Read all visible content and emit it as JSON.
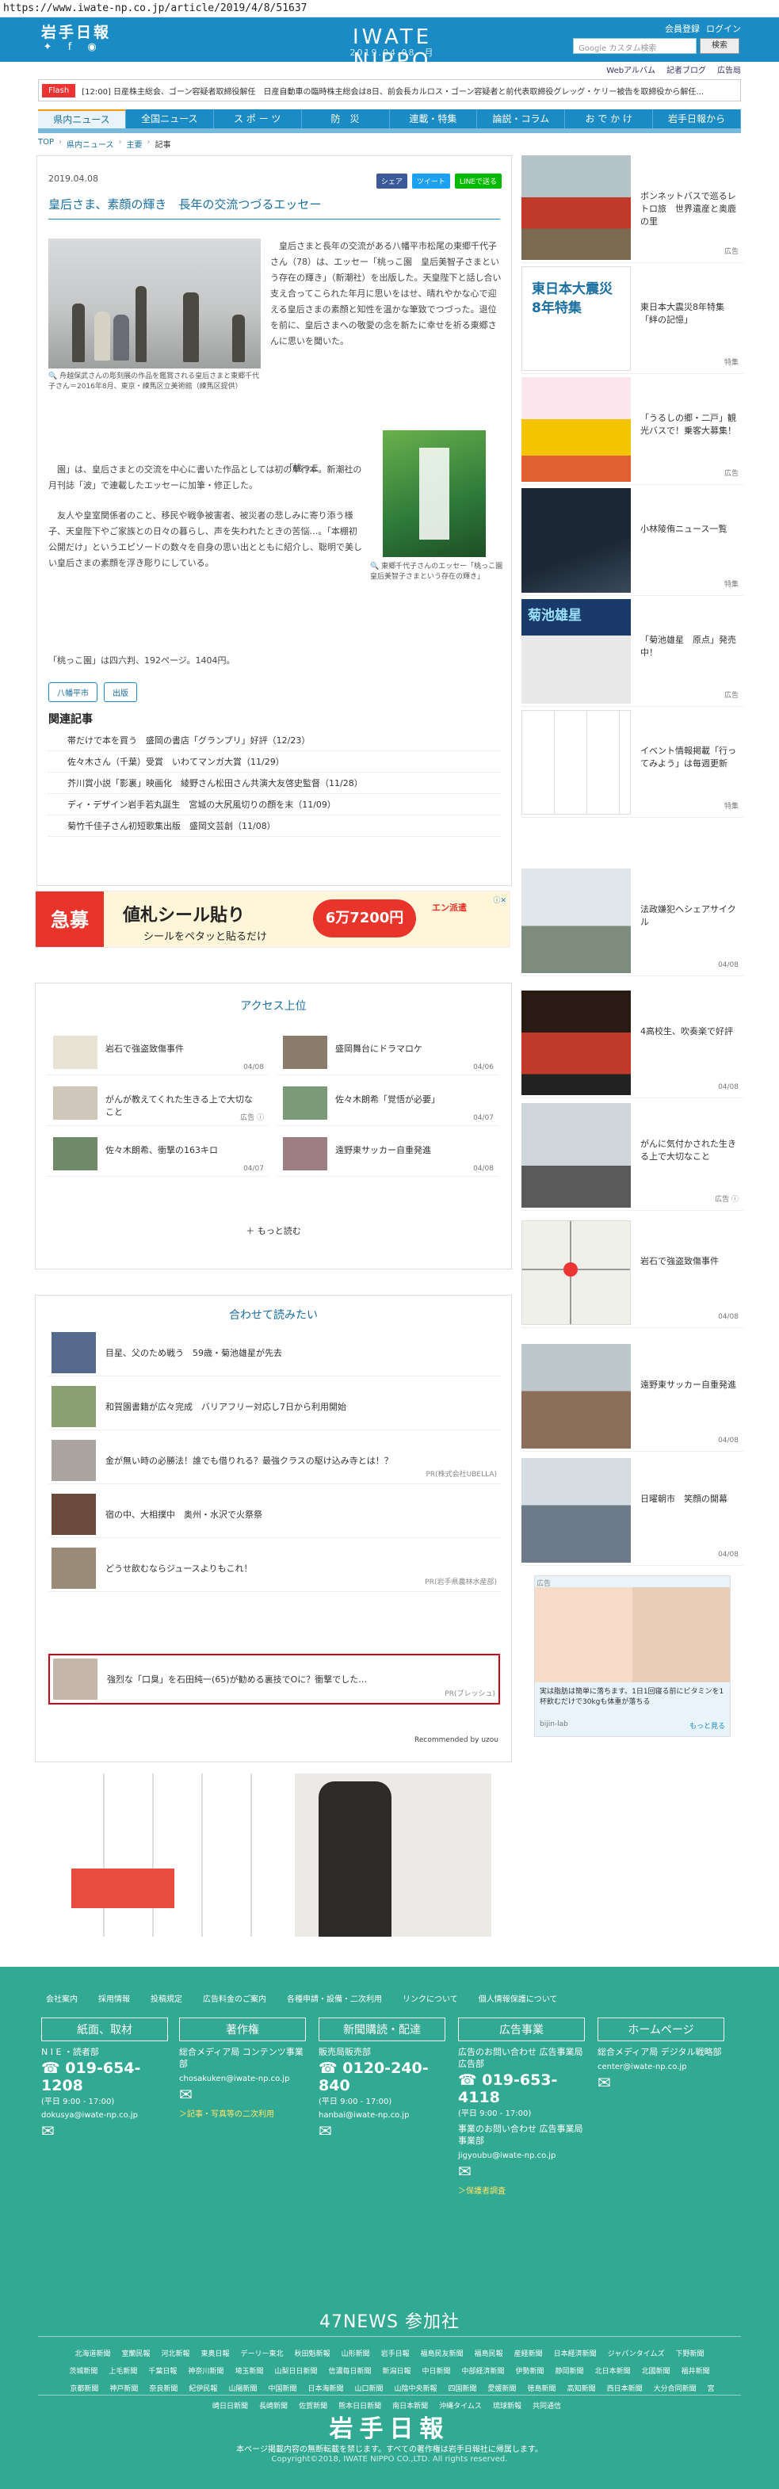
{
  "url": "https://www.iwate-np.co.jp/article/2019/4/8/51637",
  "header": {
    "logo_left": "岩手日報",
    "logo_center": "IWATE NIPPO",
    "date_line": "2019.04.08. 月",
    "top_links": [
      "会員登録",
      "ログイン"
    ],
    "search_placeholder": "Google カスタム検索",
    "search_button": "検索",
    "sub_links": [
      "Webアルバム",
      "記者ブログ",
      "広告局"
    ]
  },
  "flash": {
    "badge": "Flash",
    "text": "[12:00] 日産株主総会、ゴーン容疑者取締役解任　日産自動車の臨時株主総会は8日、前会長カルロス・ゴーン容疑者と前代表取締役グレッグ・ケリー被告を取締役から解任…"
  },
  "nav": [
    "県内ニュース",
    "全国ニュース",
    "ス ポ ー ツ",
    "防　災",
    "連載・特集",
    "論説・コラム",
    "お で か け",
    "岩手日報から"
  ],
  "breadcrumb": [
    "TOP",
    "県内ニュース",
    "主要",
    "記事"
  ],
  "article": {
    "date": "2019.04.08",
    "share": [
      "シェア",
      "ツイート",
      "LINEで送る"
    ],
    "title": "皇后さま、素顔の輝き　長年の交流つづるエッセー",
    "photo1_caption": "舟越保武さんの彫刻展の作品を鑑賞される皇后さまと東郷千代子さん＝2016年8月、東京・練馬区立美術館（練馬区提供）",
    "para1": "皇后さまと長年の交流がある八幡平市松尾の東郷千代子さん（78）は、エッセー「桃っこ園　皇后美智子さまという存在の輝き」（新潮社）を出版した。天皇陛下と話し合い支え合ってこられた年月に思いをはせ、晴れやかな心で迎える皇后さまの素顔と知性を温かな筆致でつづった。退位を前に、皇后さまへの敬愛の念を新たに幸せを祈る東郷さんに思いを聞いた。",
    "para2_lead": "「桃っこ",
    "para2": "園」は、皇后さまとの交流を中心に書いた作品としては初の単行本。新潮社の月刊誌「波」で連載したエッセーに加筆・修正した。",
    "para2b": "友人や皇室関係者のこと、移民や戦争被害者、被災者の悲しみに寄り添う様子、天皇陛下やご家族との日々の暮らし、声を失われたときの苦悩…。「本棚初公開だけ」というエピソードの数々を自身の思い出とともに紹介し、聡明で美しい皇后さまの素顔を浮き彫りにしている。",
    "book_caption": "東郷千代子さんのエッセー「桃っこ園　皇后美智子さまという存在の輝き」",
    "para3": "「桃っこ園」は四六判、192ページ。1404円。",
    "tags": [
      "八幡平市",
      "出版"
    ],
    "related_title": "関連記事",
    "related": [
      "帯だけで本を買う　盛岡の書店「グランプリ」好評（12/23）",
      "佐々木さん（千葉）受賞　いわてマンガ大賞（11/29）",
      "芥川賞小説「影裏」映画化　綾野さん松田さん共演大友啓史監督（11/28）",
      "ディ・デザイン岩手若丸誕生　宮城の大尻風切りの顔を末（11/09）",
      "菊竹千佳子さん初短歌集出版　盛岡文芸創（11/08）"
    ]
  },
  "banner": {
    "badge": "急募",
    "headline": "値札シール貼り",
    "sub": "シールをペタッと貼るだけ",
    "price": "6万7200円",
    "logo": "エン派遣"
  },
  "access": {
    "title": "アクセス上位",
    "items": [
      {
        "text": "岩石で強盗致傷事件",
        "date": "04/08"
      },
      {
        "text": "盛岡舞台にドラマロケ",
        "date": "04/06"
      },
      {
        "text": "がんが教えてくれた生きる上で大切なこと",
        "date": "広告 ⓘ"
      },
      {
        "text": "佐々木朗希「覚悟が必要」",
        "date": "04/07"
      },
      {
        "text": "佐々木朗希、衝撃の163キロ",
        "date": "04/07"
      },
      {
        "text": "遠野東サッカー自重発進",
        "date": "04/08"
      }
    ],
    "more": "もっと読む"
  },
  "recommend": {
    "title": "合わせて読みたい",
    "items": [
      {
        "text": "目星、父のため戦う　59歳・菊池雄星が先去",
        "pr": ""
      },
      {
        "text": "和賀園書籍が広々完成　バリアフリー対応し7日から利用開始",
        "pr": ""
      },
      {
        "text": "金が無い時の必勝法！誰でも借りれる？最強クラスの駆け込み寺とは！？",
        "pr": "PR(株式会社UBELLA)"
      },
      {
        "text": "宿の中、大相撲中　奥州・水沢で火祭祭",
        "pr": ""
      },
      {
        "text": "どうせ飲むならジュースよりもこれ！",
        "pr": "PR(岩手県農林水産部)"
      },
      {
        "text": "強烈な「口臭」を石田純一(65)が勧める裏技でOに？衝撃でした…",
        "pr": "PR(ブレッシュ)"
      }
    ],
    "footer": "Recommended by uzou"
  },
  "sidebar": {
    "items": [
      {
        "text": "ボンネットバスで巡るレトロ旅　世界遺産と奥鹿の里",
        "meta": "広告"
      },
      {
        "text": "東日本大震災8年特集「絆の記憶」",
        "meta": "特集"
      },
      {
        "text": "「うるしの郷・二戸」観光バスで！乗客大募集！",
        "meta": "広告"
      },
      {
        "text": "小林陵侑ニュース一覧",
        "meta": "特集"
      },
      {
        "text": "「菊池雄星　原点」発売中！",
        "meta": "広告"
      },
      {
        "text": "イベント情報掲載「行ってみよう」は毎週更新",
        "meta": "特集"
      },
      {
        "text": "法政嫌犯ヘシェアサイクル",
        "meta": "04/08"
      },
      {
        "text": "4高校生、吹奏楽で好評",
        "meta": "04/08"
      },
      {
        "text": "がんに気付かされた生きる上で大切なこと",
        "meta": "広告 ⓘ"
      },
      {
        "text": "岩石で強盗致傷事件",
        "meta": "04/08"
      },
      {
        "text": "遠野東サッカー自重発進",
        "meta": "04/08"
      },
      {
        "text": "日曜朝市　笑顔の開幕",
        "meta": "04/08"
      }
    ],
    "thumb_labels": [
      "東日本大震災8年特集",
      "菊池雄星"
    ],
    "ad_caption": "実は脂肪は簡単に落ちます。1日1回寝る前にビタミンを1杯飲むだけで30kgも体重が落ちる",
    "ad_source": "bijin-lab",
    "ad_more": "もっと見る",
    "ad_label": "広告"
  },
  "footer": {
    "links": [
      "会社案内",
      "採用情報",
      "投稿規定",
      "広告料金のご案内",
      "各種申請・設備・二次利用",
      "リンクについて",
      "個人情報保護について"
    ],
    "cols": [
      {
        "head": "紙面、取材",
        "sub": "N I E ・読者部",
        "phone": "019-654-1208",
        "hours": "(平日 9:00 - 17:00)",
        "mail": "dokusya@iwate-np.co.jp",
        "extra": ""
      },
      {
        "head": "著作権",
        "sub": "総合メディア局 コンテンツ事業部",
        "phone": "",
        "hours": "",
        "mail": "chosakuken@iwate-np.co.jp",
        "extra": "＞記事・写真等の二次利用"
      },
      {
        "head": "新聞購読・配達",
        "sub": "販売局販売部",
        "phone": "0120-240-840",
        "hours": "(平日 9:00 - 17:00)",
        "mail": "hanbai@iwate-np.co.jp",
        "extra": ""
      },
      {
        "head": "広告事業",
        "sub": "広告のお問い合わせ 広告事業局広告部",
        "phone": "019-653-4118",
        "hours": "(平日 9:00 - 17:00)",
        "mail": "jigyoubu@iwate-np.co.jp",
        "extra": "＞保護者調査",
        "sub2": "事業のお問い合わせ 広告事業局事業部"
      },
      {
        "head": "ホームページ",
        "sub": "総合メディア局 デジタル戦略部",
        "phone": "",
        "hours": "",
        "mail": "center@iwate-np.co.jp",
        "extra": ""
      }
    ],
    "title47": "47NEWS 参加社",
    "members": [
      "北海道新聞",
      "室蘭民報",
      "河北新報",
      "東奥日報",
      "デーリー東北",
      "秋田魁新報",
      "山形新聞",
      "岩手日報",
      "福島民友新聞",
      "福島民報",
      "産経新聞",
      "日本経済新聞",
      "ジャパンタイムズ",
      "下野新聞",
      "茨城新聞",
      "上毛新聞",
      "千葉日報",
      "神奈川新聞",
      "埼玉新聞",
      "山梨日日新聞",
      "信濃毎日新聞",
      "新潟日報",
      "中日新聞",
      "中部経済新聞",
      "伊勢新聞",
      "静岡新聞",
      "北日本新聞",
      "北國新聞",
      "福井新聞",
      "京都新聞",
      "神戸新聞",
      "奈良新聞",
      "紀伊民報",
      "山陽新聞",
      "中国新聞",
      "日本海新聞",
      "山口新聞",
      "山陰中央新報",
      "四国新聞",
      "愛媛新聞",
      "徳島新聞",
      "高知新聞",
      "西日本新聞",
      "大分合同新聞",
      "宮崎日日新聞",
      "長崎新聞",
      "佐賀新聞",
      "熊本日日新聞",
      "南日本新聞",
      "沖縄タイムス",
      "琉球新報",
      "共同通信"
    ],
    "logo": "岩手日報",
    "notice": "本ページ掲載内容の無断転載を禁じます。すべての著作権は岩手日報社に帰属します。",
    "copyright": "Copyright©2018, IWATE NIPPO CO.,LTD. All rights reserved."
  }
}
